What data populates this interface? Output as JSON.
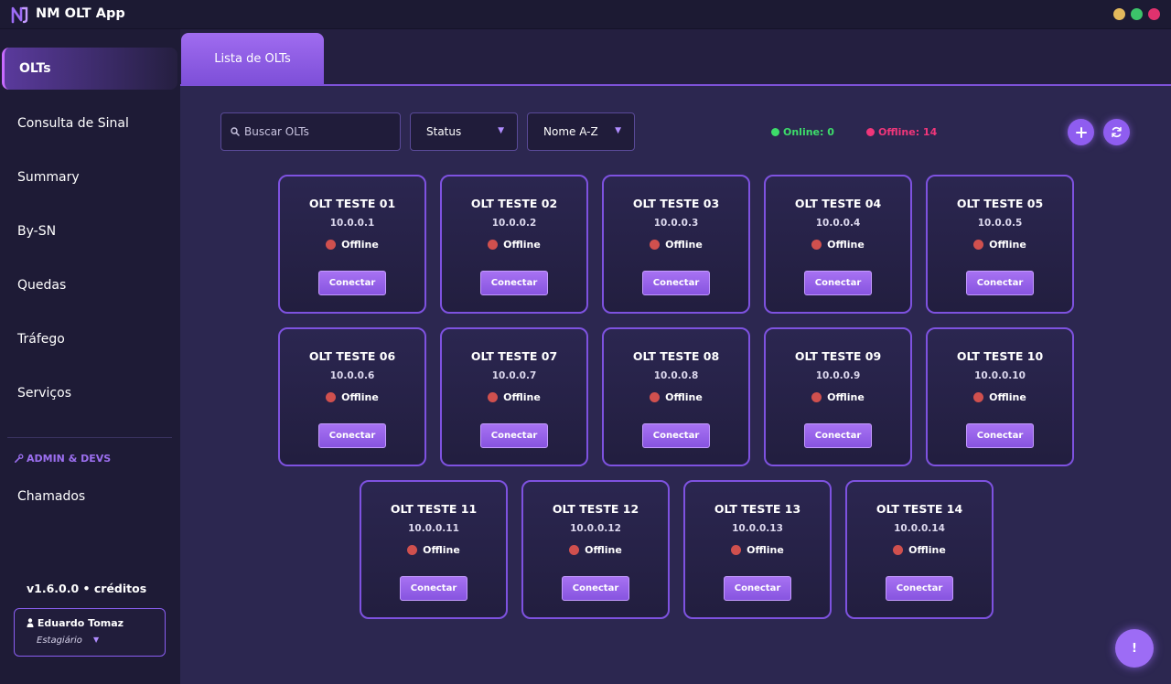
{
  "app": {
    "title": "NM OLT App",
    "colors": {
      "accent": "#8f5df0",
      "online": "#3ddc6a",
      "offline": "#f0367a",
      "status_dot_offline": "#d0504e"
    }
  },
  "window_controls": [
    "minimize-dot",
    "maximize-dot",
    "close-dot"
  ],
  "sidebar": {
    "items": [
      {
        "label": "OLTs",
        "active": true
      },
      {
        "label": "Consulta de Sinal"
      },
      {
        "label": "Summary"
      },
      {
        "label": "By-SN"
      },
      {
        "label": "Quedas"
      },
      {
        "label": "Tráfego"
      },
      {
        "label": "Serviços"
      }
    ],
    "admin_heading": "ADMIN & DEVS",
    "admin_items": [
      {
        "label": "Chamados"
      }
    ],
    "version": "v1.6.0.0 • créditos",
    "user": {
      "name": "Eduardo Tomaz",
      "role": "Estagiário"
    }
  },
  "tabs": [
    {
      "label": "Lista de OLTs",
      "active": true
    }
  ],
  "toolbar": {
    "search_placeholder": "Buscar OLTs",
    "status_filter": "Status",
    "sort": "Nome A-Z",
    "online_count": "Online: 0",
    "offline_count": "Offline: 14",
    "add_icon": "plus-icon",
    "refresh_icon": "refresh-icon",
    "alert_label": "!"
  },
  "olts": [
    {
      "name": "OLT TESTE 01",
      "ip": "10.0.0.1",
      "status": "Offline",
      "action": "Conectar"
    },
    {
      "name": "OLT TESTE 02",
      "ip": "10.0.0.2",
      "status": "Offline",
      "action": "Conectar"
    },
    {
      "name": "OLT TESTE 03",
      "ip": "10.0.0.3",
      "status": "Offline",
      "action": "Conectar"
    },
    {
      "name": "OLT TESTE 04",
      "ip": "10.0.0.4",
      "status": "Offline",
      "action": "Conectar"
    },
    {
      "name": "OLT TESTE 05",
      "ip": "10.0.0.5",
      "status": "Offline",
      "action": "Conectar"
    },
    {
      "name": "OLT TESTE 06",
      "ip": "10.0.0.6",
      "status": "Offline",
      "action": "Conectar"
    },
    {
      "name": "OLT TESTE 07",
      "ip": "10.0.0.7",
      "status": "Offline",
      "action": "Conectar"
    },
    {
      "name": "OLT TESTE 08",
      "ip": "10.0.0.8",
      "status": "Offline",
      "action": "Conectar"
    },
    {
      "name": "OLT TESTE 09",
      "ip": "10.0.0.9",
      "status": "Offline",
      "action": "Conectar"
    },
    {
      "name": "OLT TESTE 10",
      "ip": "10.0.0.10",
      "status": "Offline",
      "action": "Conectar"
    },
    {
      "name": "OLT TESTE 11",
      "ip": "10.0.0.11",
      "status": "Offline",
      "action": "Conectar"
    },
    {
      "name": "OLT TESTE 12",
      "ip": "10.0.0.12",
      "status": "Offline",
      "action": "Conectar"
    },
    {
      "name": "OLT TESTE 13",
      "ip": "10.0.0.13",
      "status": "Offline",
      "action": "Conectar"
    },
    {
      "name": "OLT TESTE 14",
      "ip": "10.0.0.14",
      "status": "Offline",
      "action": "Conectar"
    }
  ]
}
